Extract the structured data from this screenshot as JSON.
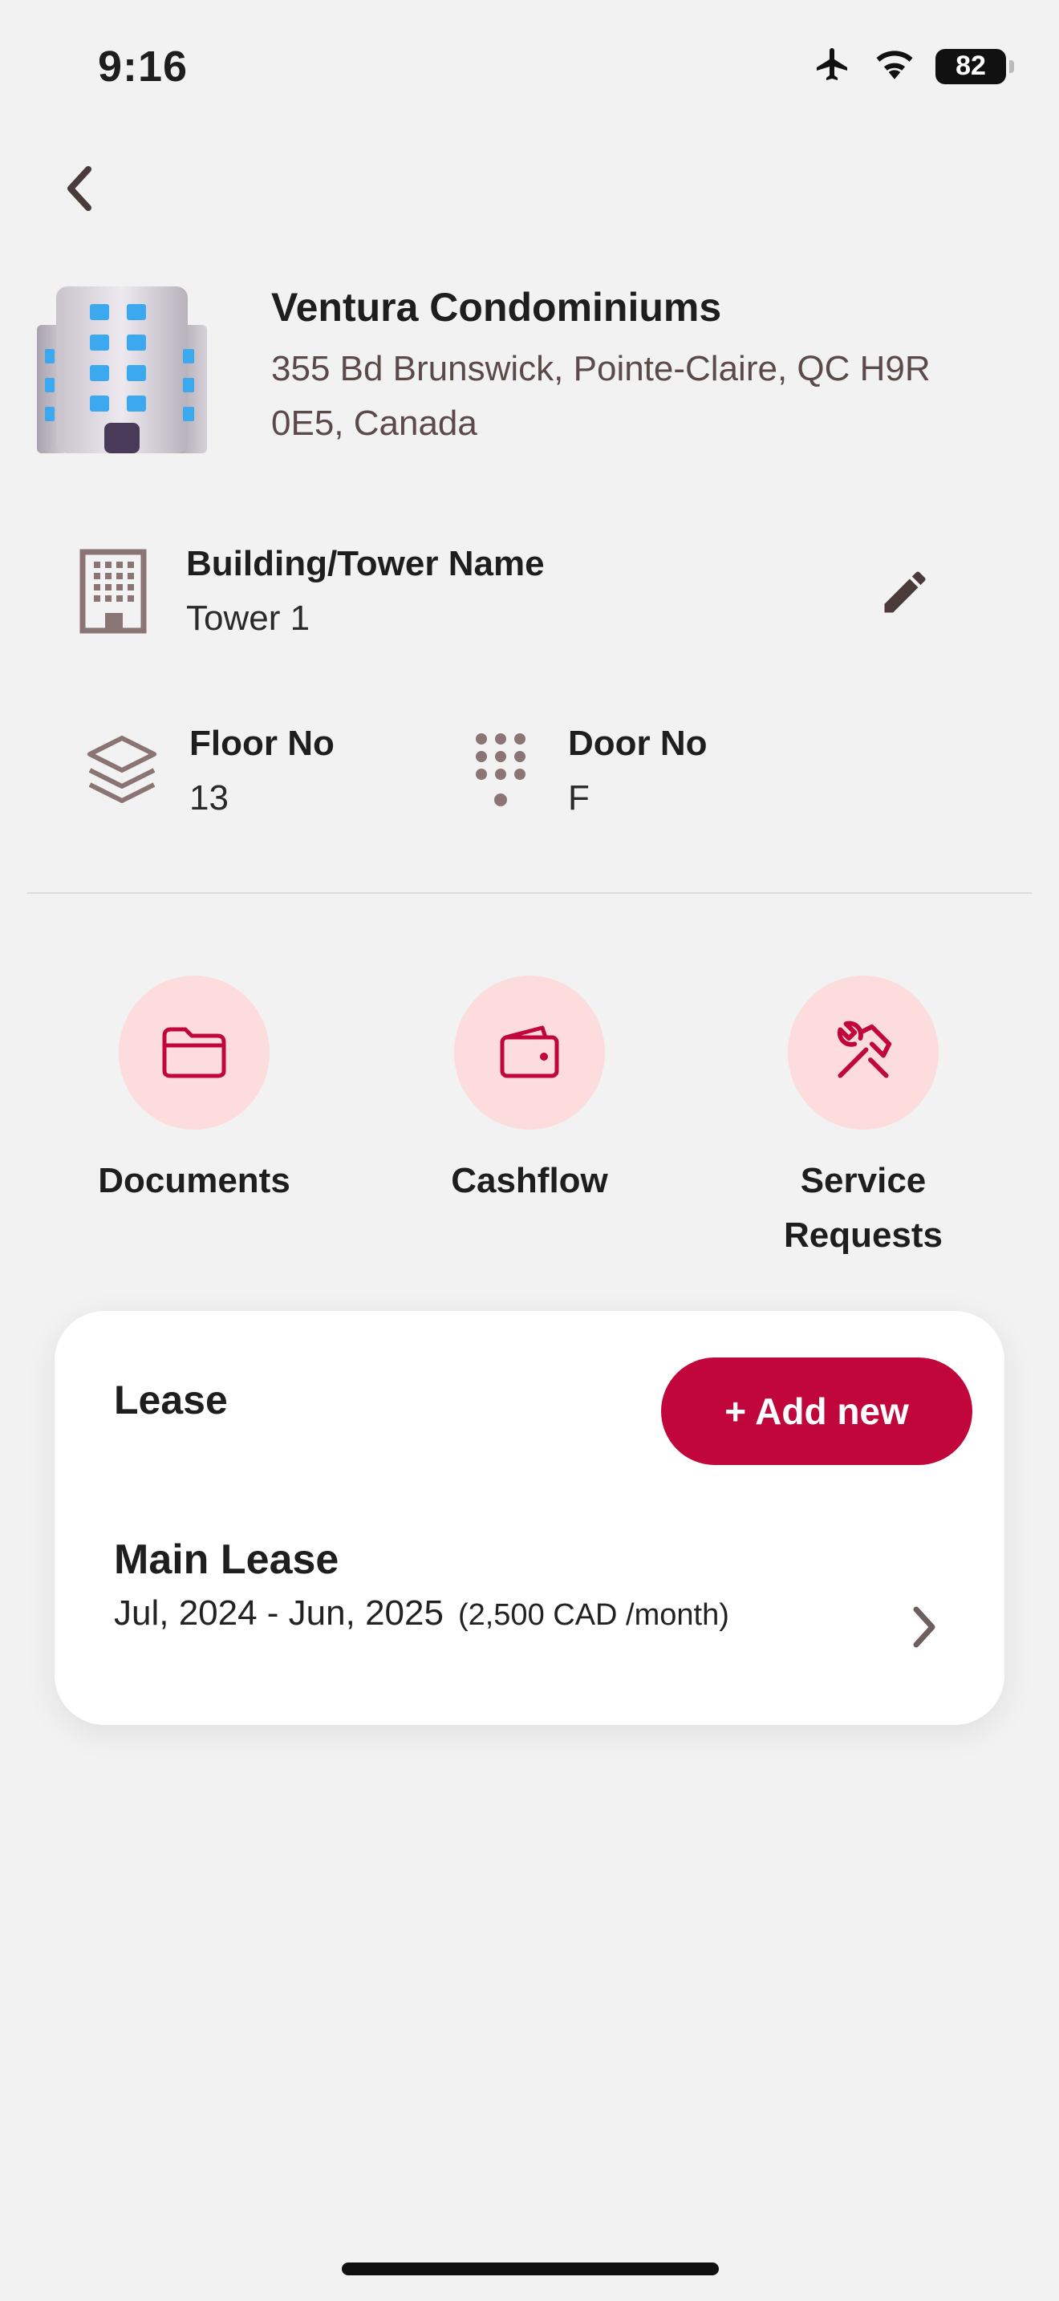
{
  "status_bar": {
    "time": "9:16",
    "battery": "82"
  },
  "property": {
    "name": "Ventura Condominiums",
    "address": "355 Bd Brunswick, Pointe-Claire, QC H9R 0E5, Canada"
  },
  "details": {
    "building_label": "Building/Tower Name",
    "building_value": "Tower 1",
    "floor_label": "Floor No",
    "floor_value": "13",
    "door_label": "Door No",
    "door_value": "F"
  },
  "actions": [
    {
      "label": "Documents",
      "icon": "folder-icon"
    },
    {
      "label": "Cashflow",
      "icon": "wallet-icon"
    },
    {
      "label": "Service Requests",
      "icon": "tools-icon"
    }
  ],
  "lease": {
    "title": "Lease",
    "add_label": "+ Add new",
    "items": [
      {
        "name": "Main Lease",
        "period": "Jul, 2024 - Jun, 2025",
        "rent": "(2,500 CAD /month)"
      }
    ]
  },
  "colors": {
    "accent": "#c0063a",
    "accent_light": "#fcdcdc",
    "icon_brown": "#8a7474",
    "background": "#f2f2f2"
  }
}
